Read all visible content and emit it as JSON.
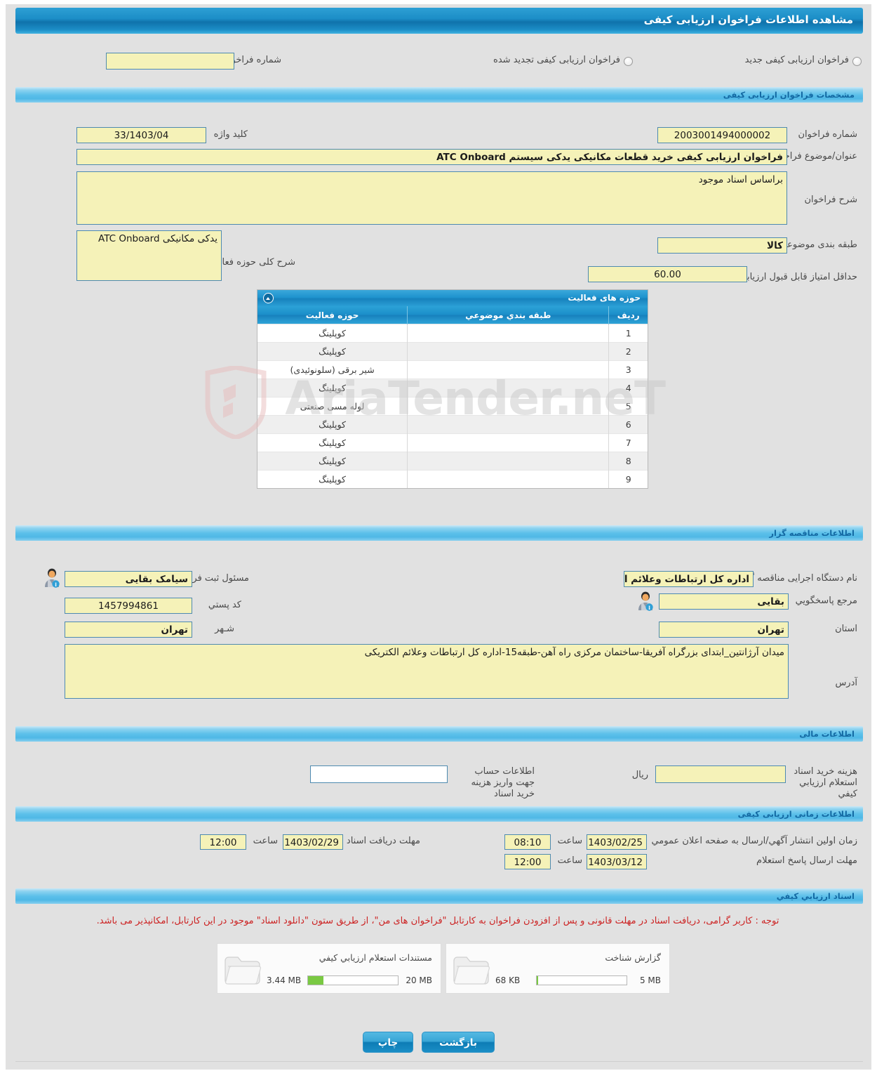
{
  "page": {
    "title": "مشاهده اطلاعات فراخوان ارزیابی کیفی"
  },
  "top_selector": {
    "radio_new_label": "فراخوان ارزیابی کیفی جدید",
    "radio_renewed_label": "فراخوان ارزیابی کیفی تجدید شده",
    "prev_number_label": "شماره فراخوان قبلی",
    "prev_number_value": ""
  },
  "specs": {
    "section_title": "مشخصات فراخوان ارزیابی کیفی",
    "call_number_label": "شماره فراخوان",
    "call_number_value": "2003001494000002",
    "keyword_label": "کلید واژه",
    "keyword_value": "33/1403/04",
    "subject_label": "عنوان/موضوع فراخوان",
    "subject_value": "فراخوان ارزیابی کیفی خرید قطعات مکانیکی یدکی سیستم ATC Onboard",
    "description_label": "شرح فراخوان",
    "description_value": "براساس اسناد موجود",
    "category_label": "طبقه بندی موضوعي",
    "category_value": "کالا",
    "activity_desc_label": "شرح کلی حوزه فعالیت",
    "activity_desc_value": "یدکی مکانیکی ATC Onboard",
    "min_score_label": "حداقل امتیاز قابل قبول ارزیابي کیفي",
    "min_score_value": "60.00"
  },
  "activity_table": {
    "title": "حوزه های فعالیت",
    "columns": [
      "ردیف",
      "طبقه بندي موضوعي",
      "حوزه فعالیت"
    ],
    "rows": [
      {
        "radif": "1",
        "tabaghe": "",
        "hoze": "کوپلینگ"
      },
      {
        "radif": "2",
        "tabaghe": "",
        "hoze": "کوپلینگ"
      },
      {
        "radif": "3",
        "tabaghe": "",
        "hoze": "شیر برقی (سلونوئیدی)"
      },
      {
        "radif": "4",
        "tabaghe": "",
        "hoze": "کوپلینگ"
      },
      {
        "radif": "5",
        "tabaghe": "",
        "hoze": "لوله مسی صنعتی"
      },
      {
        "radif": "6",
        "tabaghe": "",
        "hoze": "کوپلینگ"
      },
      {
        "radif": "7",
        "tabaghe": "",
        "hoze": "کوپلینگ"
      },
      {
        "radif": "8",
        "tabaghe": "",
        "hoze": "کوپلینگ"
      },
      {
        "radif": "9",
        "tabaghe": "",
        "hoze": "کوپلینگ"
      }
    ]
  },
  "watermark": {
    "text": "AriaTender.neT"
  },
  "organizer": {
    "section_title": "اطلاعات مناقصه گزار",
    "agency_label": "نام دستگاه اجرایی مناقصه گزار",
    "agency_value": "اداره کل ارتباطات وعلائم الکتریکی",
    "registrar_label": "مسئول ثبت فراخوان",
    "registrar_value": "سیامک بقایی",
    "contact_label": "مرجع پاسخگويي",
    "contact_value": "بقایی",
    "postal_code_label": "کد پستي",
    "postal_code_value": "1457994861",
    "province_label": "استان",
    "province_value": "تهران",
    "city_label": "شـهر",
    "city_value": "تهران",
    "address_label": "آدرس",
    "address_value": "میدان آرژانتین_ابتدای بزرگراه آفریقا-ساختمان مرکزی راه آهن-طبقه15-اداره کل ارتباطات وعلائم الکتریکی"
  },
  "financial": {
    "section_title": "اطلاعات مالی",
    "doc_cost_label": "هزینه خرید اسناد استعلام ارزیابي کیفي",
    "doc_cost_value": "",
    "currency_label": "ریال",
    "account_info_label": "اطلاعات حساب جهت واریز هزینه خرید اسناد",
    "account_info_value": ""
  },
  "timing": {
    "section_title": "اطلاعات زمانی ارزیابی کیفی",
    "publish_label": "زمان اولین انتشار آگهي/ارسال به صفحه اعلان عمومي",
    "publish_date": "1403/02/25",
    "publish_hour_label": "ساعت",
    "publish_hour": "08:10",
    "doc_deadline_label": "مهلت دریافت اسناد",
    "doc_deadline_date": "1403/02/29",
    "doc_deadline_hour_label": "ساعت",
    "doc_deadline_hour": "12:00",
    "reply_label": "مهلت ارسال پاسخ استعلام",
    "reply_date": "1403/03/12",
    "reply_hour_label": "ساعت",
    "reply_hour": "12:00"
  },
  "documents": {
    "section_title": "اسناد ارزیابي کیفي",
    "notice": "توجه : کاربر گرامی، دریافت اسناد در مهلت قانونی و پس از افزودن فراخوان به کارتابل \"فراخوان های من\"، از طریق ستون \"دانلود اسناد\" موجود در این کارتابل، امکانپذیر می باشد.",
    "attachments": [
      {
        "name": "گزارش شناخت",
        "used": "68 KB",
        "limit": "5 MB",
        "percent": 1.3
      },
      {
        "name": "مستندات استعلام ارزیابي کیفي",
        "used": "3.44 MB",
        "limit": "20 MB",
        "percent": 17.2
      }
    ]
  },
  "footer": {
    "print_label": "چاپ",
    "back_label": "بازگشت"
  },
  "colors": {
    "title_bar": "#1c8ec7",
    "section_bar": "#5cc0ea",
    "field_bg": "#f5f2b8",
    "field_border": "#4e8ab0",
    "page_bg": "#e1e1e1",
    "notice_text": "#cc2222",
    "meter_fill": "#7ac943"
  }
}
